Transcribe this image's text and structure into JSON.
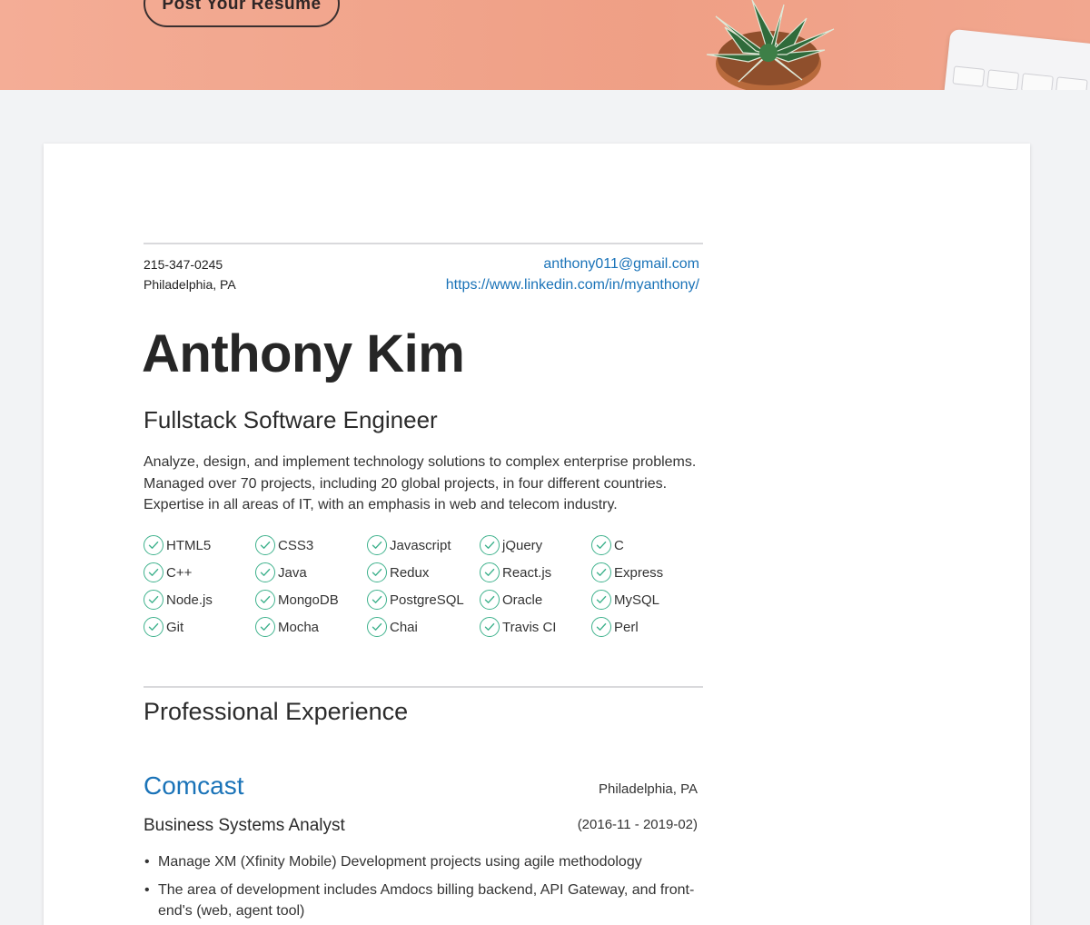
{
  "hero": {
    "post_resume_label": "Post Your Resume"
  },
  "contact": {
    "phone": "215-347-0245",
    "location": "Philadelphia, PA",
    "email": "anthony011@gmail.com",
    "linkedin": "https://www.linkedin.com/in/myanthony/"
  },
  "resume": {
    "name": "Anthony Kim",
    "title": "Fullstack Software Engineer",
    "summary": "Analyze, design, and implement technology solutions to complex enterprise problems. Managed over 70 projects, including 20 global projects, in four different countries. Expertise in all areas of IT, with an emphasis in web and telecom industry."
  },
  "skills": [
    "HTML5",
    "CSS3",
    "Javascript",
    "jQuery",
    "C",
    "C++",
    "Java",
    "Redux",
    "React.js",
    "Express",
    "Node.js",
    "MongoDB",
    "PostgreSQL",
    "Oracle",
    "MySQL",
    "Git",
    "Mocha",
    "Chai",
    "Travis CI",
    "Perl"
  ],
  "experience": {
    "section_title": "Professional Experience",
    "jobs": [
      {
        "company": "Comcast",
        "location": "Philadelphia, PA",
        "role": "Business Systems Analyst",
        "dates": "(2016-11 - 2019-02)",
        "bullets": [
          "Manage XM (Xfinity Mobile) Development projects using agile methodology",
          "The area of development includes Amdocs billing backend, API Gateway, and front-end's (web, agent tool)"
        ]
      }
    ]
  },
  "colors": {
    "accent_link": "#1a73b8",
    "check_green": "#3fb28d",
    "hero_bg": "#ef9f85"
  },
  "icons": {
    "skill_check": "check-circle-icon"
  }
}
